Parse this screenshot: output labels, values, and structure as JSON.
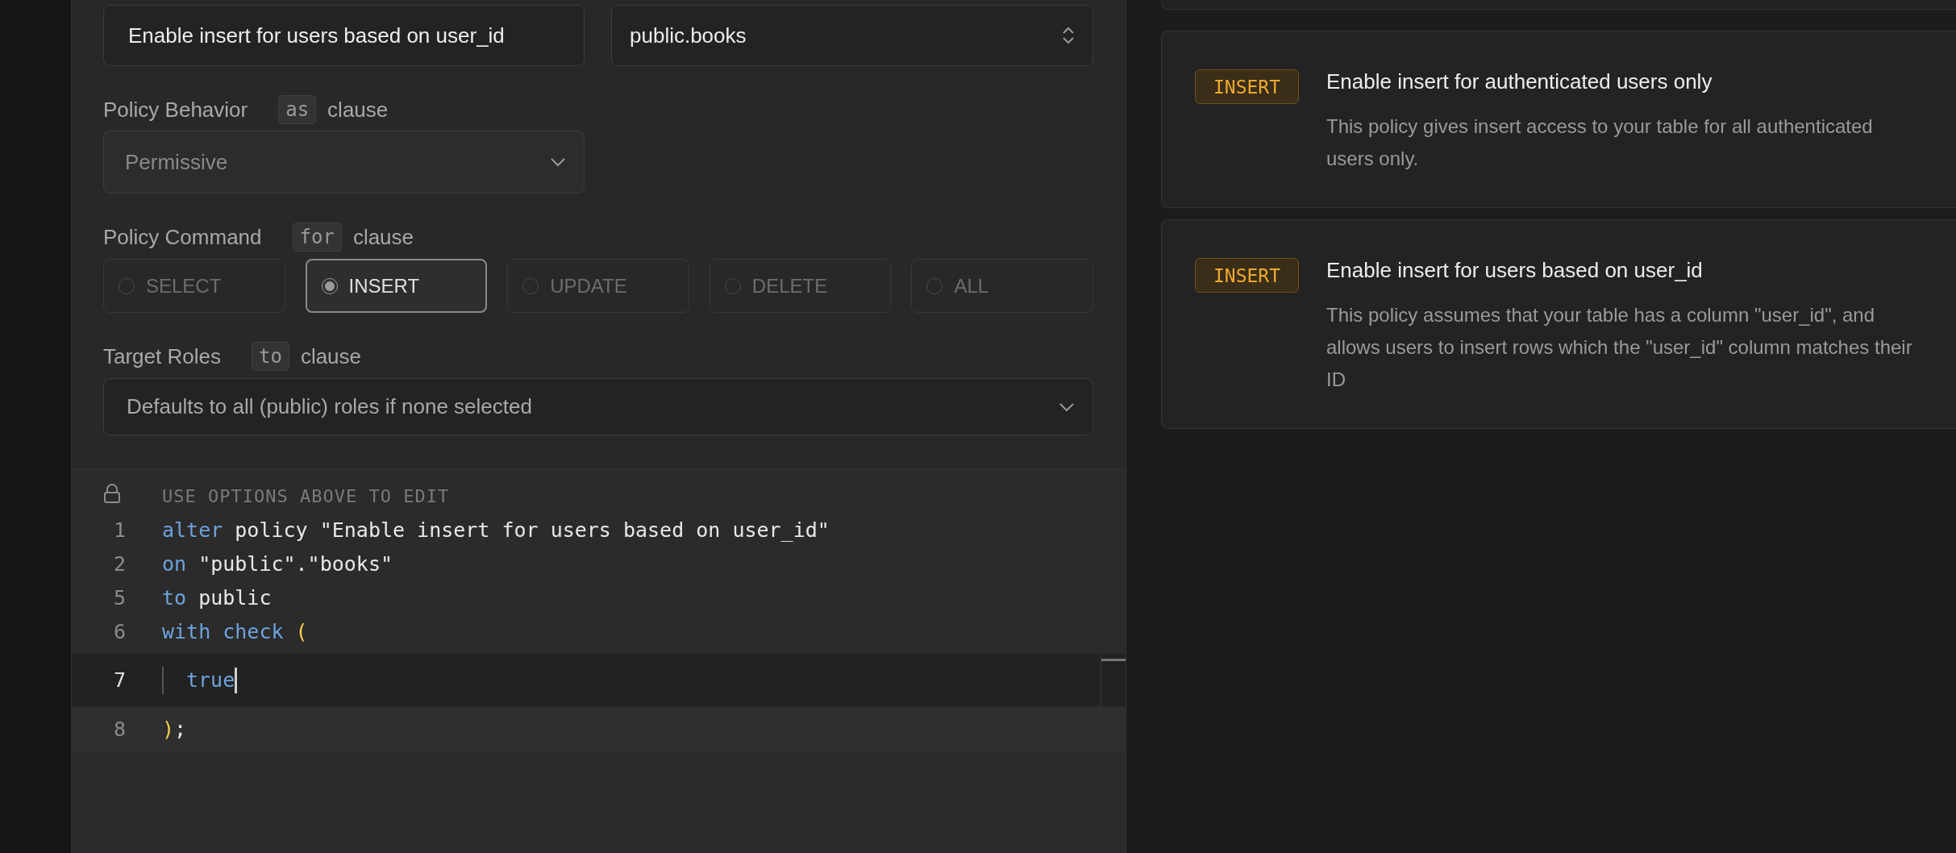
{
  "policy_name": {
    "value": "Enable insert for users based on user_id"
  },
  "table": {
    "value": "public.books"
  },
  "behavior": {
    "label": "Policy Behavior",
    "keyword": "as",
    "suffix": "clause",
    "value": "Permissive",
    "disabled": true
  },
  "command": {
    "label": "Policy Command",
    "keyword": "for",
    "suffix": "clause",
    "options": [
      {
        "label": "SELECT",
        "selected": false
      },
      {
        "label": "INSERT",
        "selected": true
      },
      {
        "label": "UPDATE",
        "selected": false
      },
      {
        "label": "DELETE",
        "selected": false
      },
      {
        "label": "ALL",
        "selected": false
      }
    ]
  },
  "roles": {
    "label": "Target Roles",
    "keyword": "to",
    "suffix": "clause",
    "placeholder": "Defaults to all (public) roles if none selected"
  },
  "editor": {
    "header": "USE OPTIONS ABOVE TO EDIT",
    "lines": [
      {
        "number": "1",
        "active": false,
        "indented": false,
        "tokens": [
          {
            "kind": "keyword",
            "text": "alter"
          },
          {
            "kind": "plain",
            "text": " policy \"Enable insert for users based on user_id\""
          }
        ]
      },
      {
        "number": "2",
        "active": false,
        "indented": false,
        "tokens": [
          {
            "kind": "keyword",
            "text": "on"
          },
          {
            "kind": "plain",
            "text": " \"public\".\"books\""
          }
        ]
      },
      {
        "number": "5",
        "active": false,
        "indented": false,
        "tokens": [
          {
            "kind": "keyword",
            "text": "to"
          },
          {
            "kind": "plain",
            "text": " public"
          }
        ]
      },
      {
        "number": "6",
        "active": false,
        "indented": false,
        "tokens": [
          {
            "kind": "keyword",
            "text": "with check "
          },
          {
            "kind": "bracket",
            "text": "("
          }
        ]
      },
      {
        "number": "7",
        "active": true,
        "indented": true,
        "tokens": [
          {
            "kind": "keyword",
            "text": "true"
          }
        ]
      },
      {
        "number": "8",
        "active": false,
        "indented": false,
        "tokens": [
          {
            "kind": "bracket",
            "text": ")"
          },
          {
            "kind": "plain",
            "text": ";"
          }
        ]
      }
    ]
  },
  "templates": [
    {
      "badge": "INSERT",
      "title": "Enable insert for authenticated users only",
      "description": "This policy gives insert access to your table for all authenticated users only."
    },
    {
      "badge": "INSERT",
      "title": "Enable insert for users based on user_id",
      "description": "This policy assumes that your table has a column \"user_id\", and allows users to insert rows which the \"user_id\" column matches their ID"
    }
  ]
}
